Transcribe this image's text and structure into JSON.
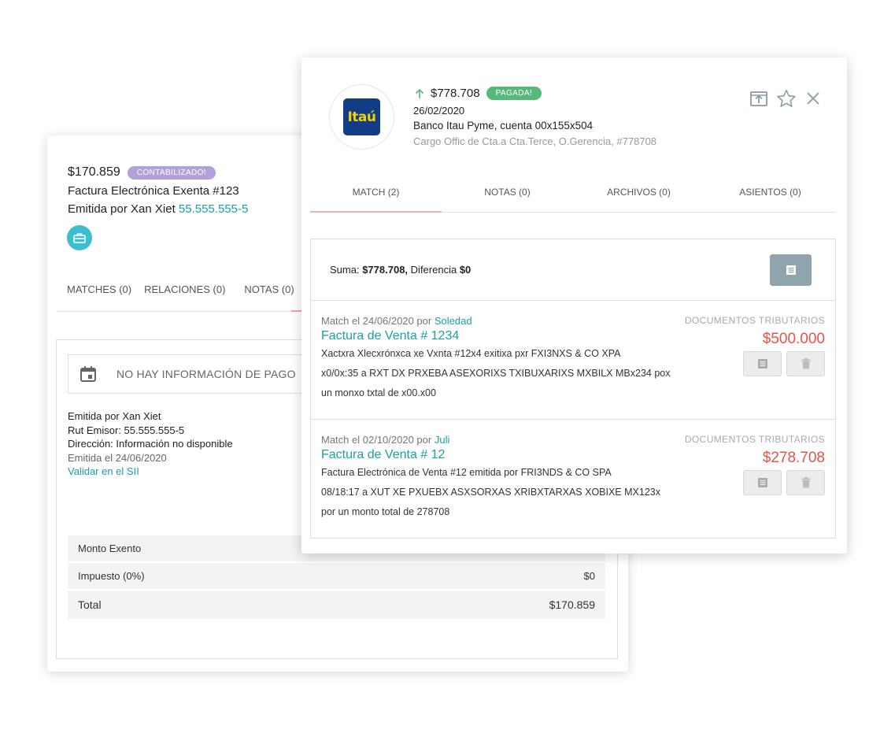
{
  "invoice_card": {
    "amount": "$170.859",
    "status_badge": "CONTABILIZADO!",
    "title": "Factura Electrónica Exenta #123",
    "issuer_prefix": "Emitida por Xan Xiet",
    "issuer_rut": "55.555.555-5",
    "icon": "briefcase-icon",
    "tabs": [
      "MATCHES (0)",
      "RELACIONES (0)",
      "NOTAS (0)"
    ],
    "payment_info": "NO HAY INFORMACIÓN DE PAGO",
    "details": {
      "emitted_by_label": "Emitida por",
      "emitted_by_value": "Xan Xiet",
      "rut_label": "Rut Emisor:",
      "rut_value": "55.555.555-5",
      "address_label": "Dirección:",
      "address_value": "Información no disponible",
      "emitted_date": "Emitida el 24/06/2020",
      "validate_link": "Validar en el SII"
    },
    "totals": [
      {
        "label": "Monto Exento",
        "value": ""
      },
      {
        "label": "Impuesto (0%)",
        "value": "$0"
      },
      {
        "label": "Total",
        "value": "$170.859"
      }
    ]
  },
  "transaction_card": {
    "bank_logo_text": "Itaú",
    "amount": "$778.708",
    "status_badge": "PAGADA!",
    "date": "26/02/2020",
    "account": "Banco Itau Pyme, cuenta 00x155x504",
    "description": "Cargo Offic de Cta.a Cta.Terce, O.Gerencia, #778708",
    "tabs": [
      "MATCH (2)",
      "NOTAS (0)",
      "ARCHIVOS (0)",
      "ASIENTOS (0)"
    ],
    "sum_label": "Suma:",
    "sum_value": "$778.708,",
    "diff_label": "Diferencia",
    "diff_value": "$0",
    "matches": [
      {
        "meta_prefix": "Match el 24/06/2020 por",
        "user": "Soledad",
        "title": "Factura de Venta # 1234",
        "lines": [
          "Xactxra Xlecxrónxca xe Vxnta #12x4 exitixa pxr FXI3NXS & CO XPA",
          "x0/0x:35 a RXT DX PRXEBA ASEXORIXS TXIBUXARIXS MXBILX MBx234 pox",
          "un monxo txtal de x00.x00"
        ],
        "doc_type": "DOCUMENTOS TRIBUTARIOS",
        "doc_amount": "$500.000"
      },
      {
        "meta_prefix": "Match el 02/10/2020 por",
        "user": "Juli",
        "title": "Factura de Venta # 12",
        "lines": [
          "Factura Electrónica de Venta #12 emitida por FRI3NDS & CO SPA",
          "08/18:17 a XUT XE PXUEBX ASXSORXAS XRIBXTARXAS XOBIXE MX123x",
          "por un monto total de 278708"
        ],
        "doc_type": "DOCUMENTOS TRIBUTARIOS",
        "doc_amount": "$278.708"
      }
    ]
  }
}
